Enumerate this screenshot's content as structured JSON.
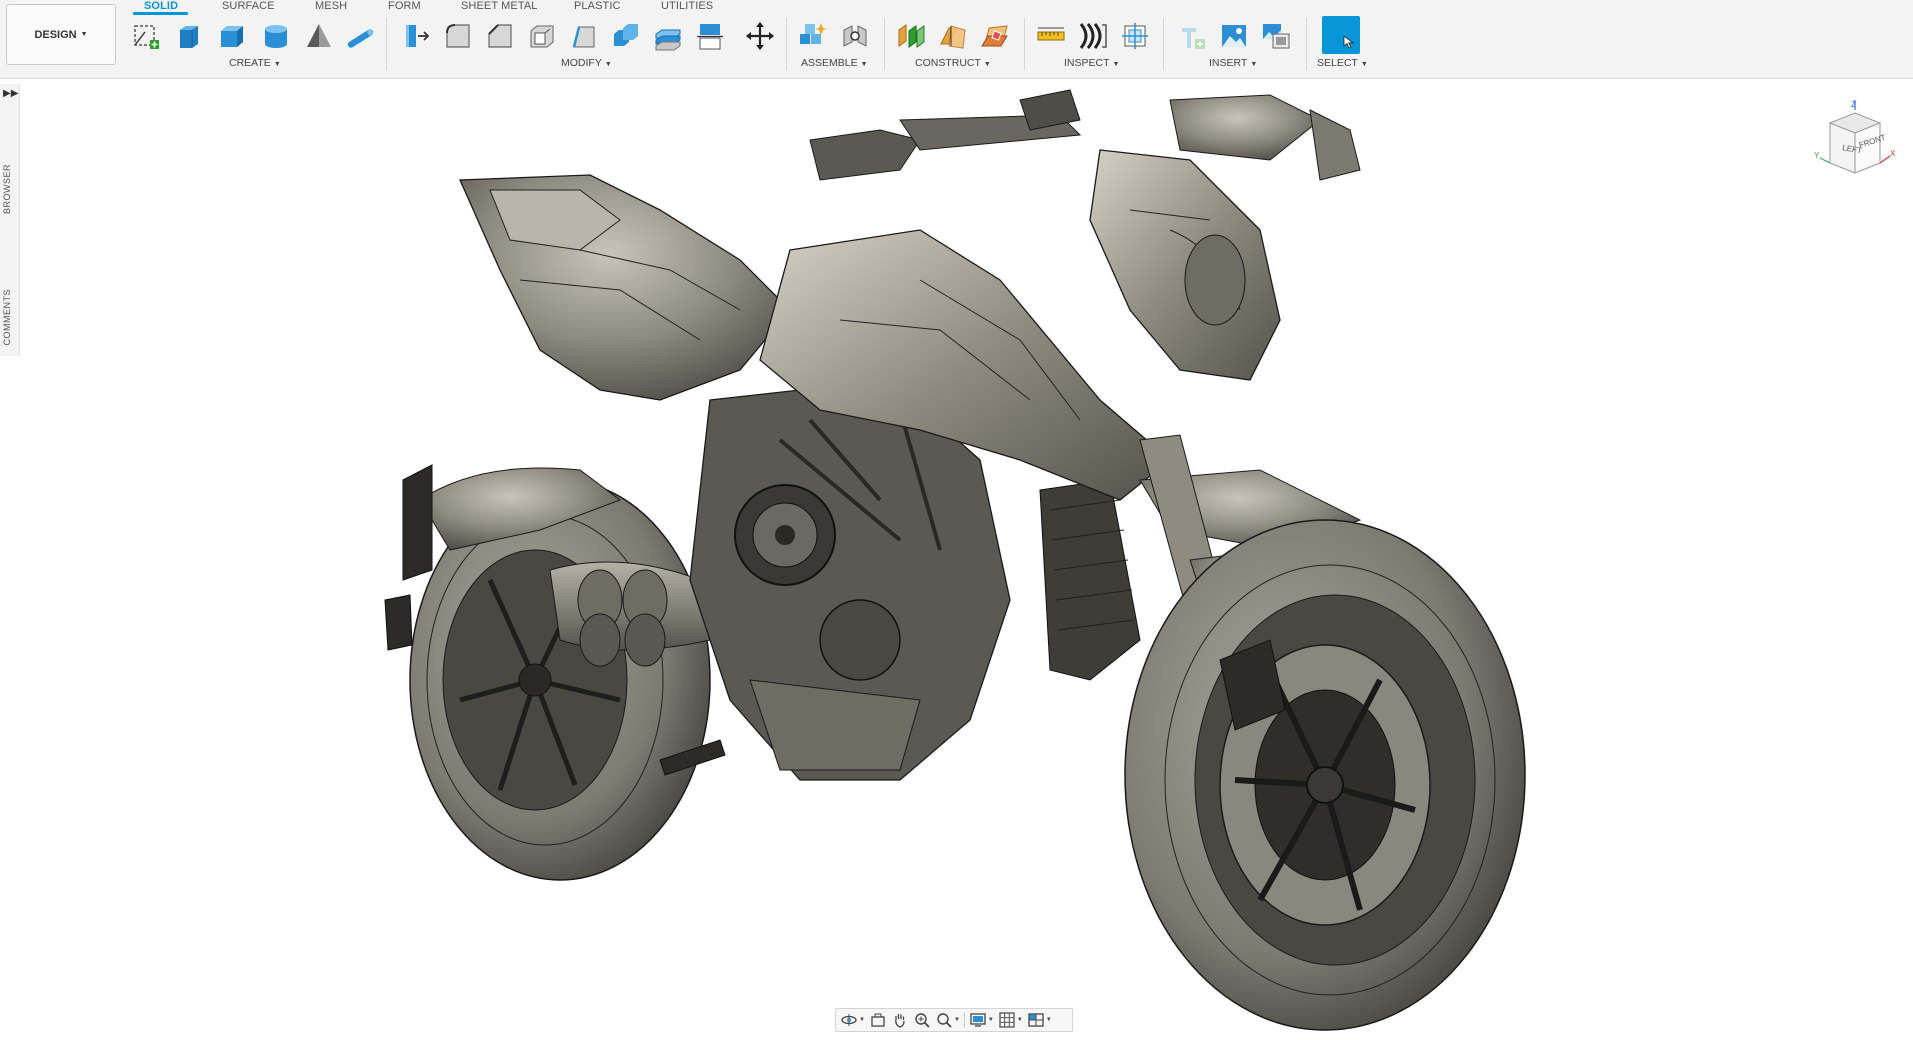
{
  "app": {
    "workspace_button": "DESIGN",
    "tabs": [
      "SOLID",
      "SURFACE",
      "MESH",
      "FORM",
      "SHEET METAL",
      "PLASTIC",
      "UTILITIES"
    ],
    "active_tab": "SOLID"
  },
  "toolbar": {
    "groups": {
      "create": "CREATE",
      "modify": "MODIFY",
      "assemble": "ASSEMBLE",
      "construct": "CONSTRUCT",
      "inspect": "INSPECT",
      "insert": "INSERT",
      "select": "SELECT"
    },
    "icons": {
      "create": [
        "sketch-icon",
        "extrude-icon",
        "box-icon",
        "cylinder-icon",
        "revolve-icon",
        "pipe-icon"
      ],
      "modify": [
        "press-pull-icon",
        "fillet-icon",
        "chamfer-icon",
        "shell-icon",
        "draft-icon",
        "combine-icon",
        "offset-face-icon",
        "split-body-icon",
        "move-icon"
      ],
      "assemble": [
        "new-component-icon",
        "joint-icon"
      ],
      "construct": [
        "offset-plane-icon",
        "plane-at-angle-icon",
        "midplane-icon"
      ],
      "inspect": [
        "measure-icon",
        "zebra-icon",
        "section-analysis-icon"
      ],
      "insert": [
        "insert-mesh-icon",
        "decal-icon",
        "canvas-icon"
      ],
      "select": [
        "select-icon"
      ]
    },
    "accent_color": "#0696d7"
  },
  "left_panel": {
    "tabs": [
      "BROWSER",
      "COMMENTS"
    ]
  },
  "viewcube": {
    "faces": [
      "LEFT",
      "FRONT"
    ],
    "axes": [
      "Z",
      "Y",
      "X"
    ]
  },
  "navbar": {
    "icons": [
      "orbit-icon",
      "look-at-icon",
      "pan-icon",
      "zoom-icon",
      "fit-icon",
      "display-settings-icon",
      "grid-icon",
      "viewports-icon"
    ]
  },
  "viewport": {
    "model": "motorcycle-model",
    "colors": {
      "body": "#8d8a80",
      "dark": "#3a3935",
      "tire": "#7d7a72",
      "edges": "#1a1a1a"
    }
  }
}
